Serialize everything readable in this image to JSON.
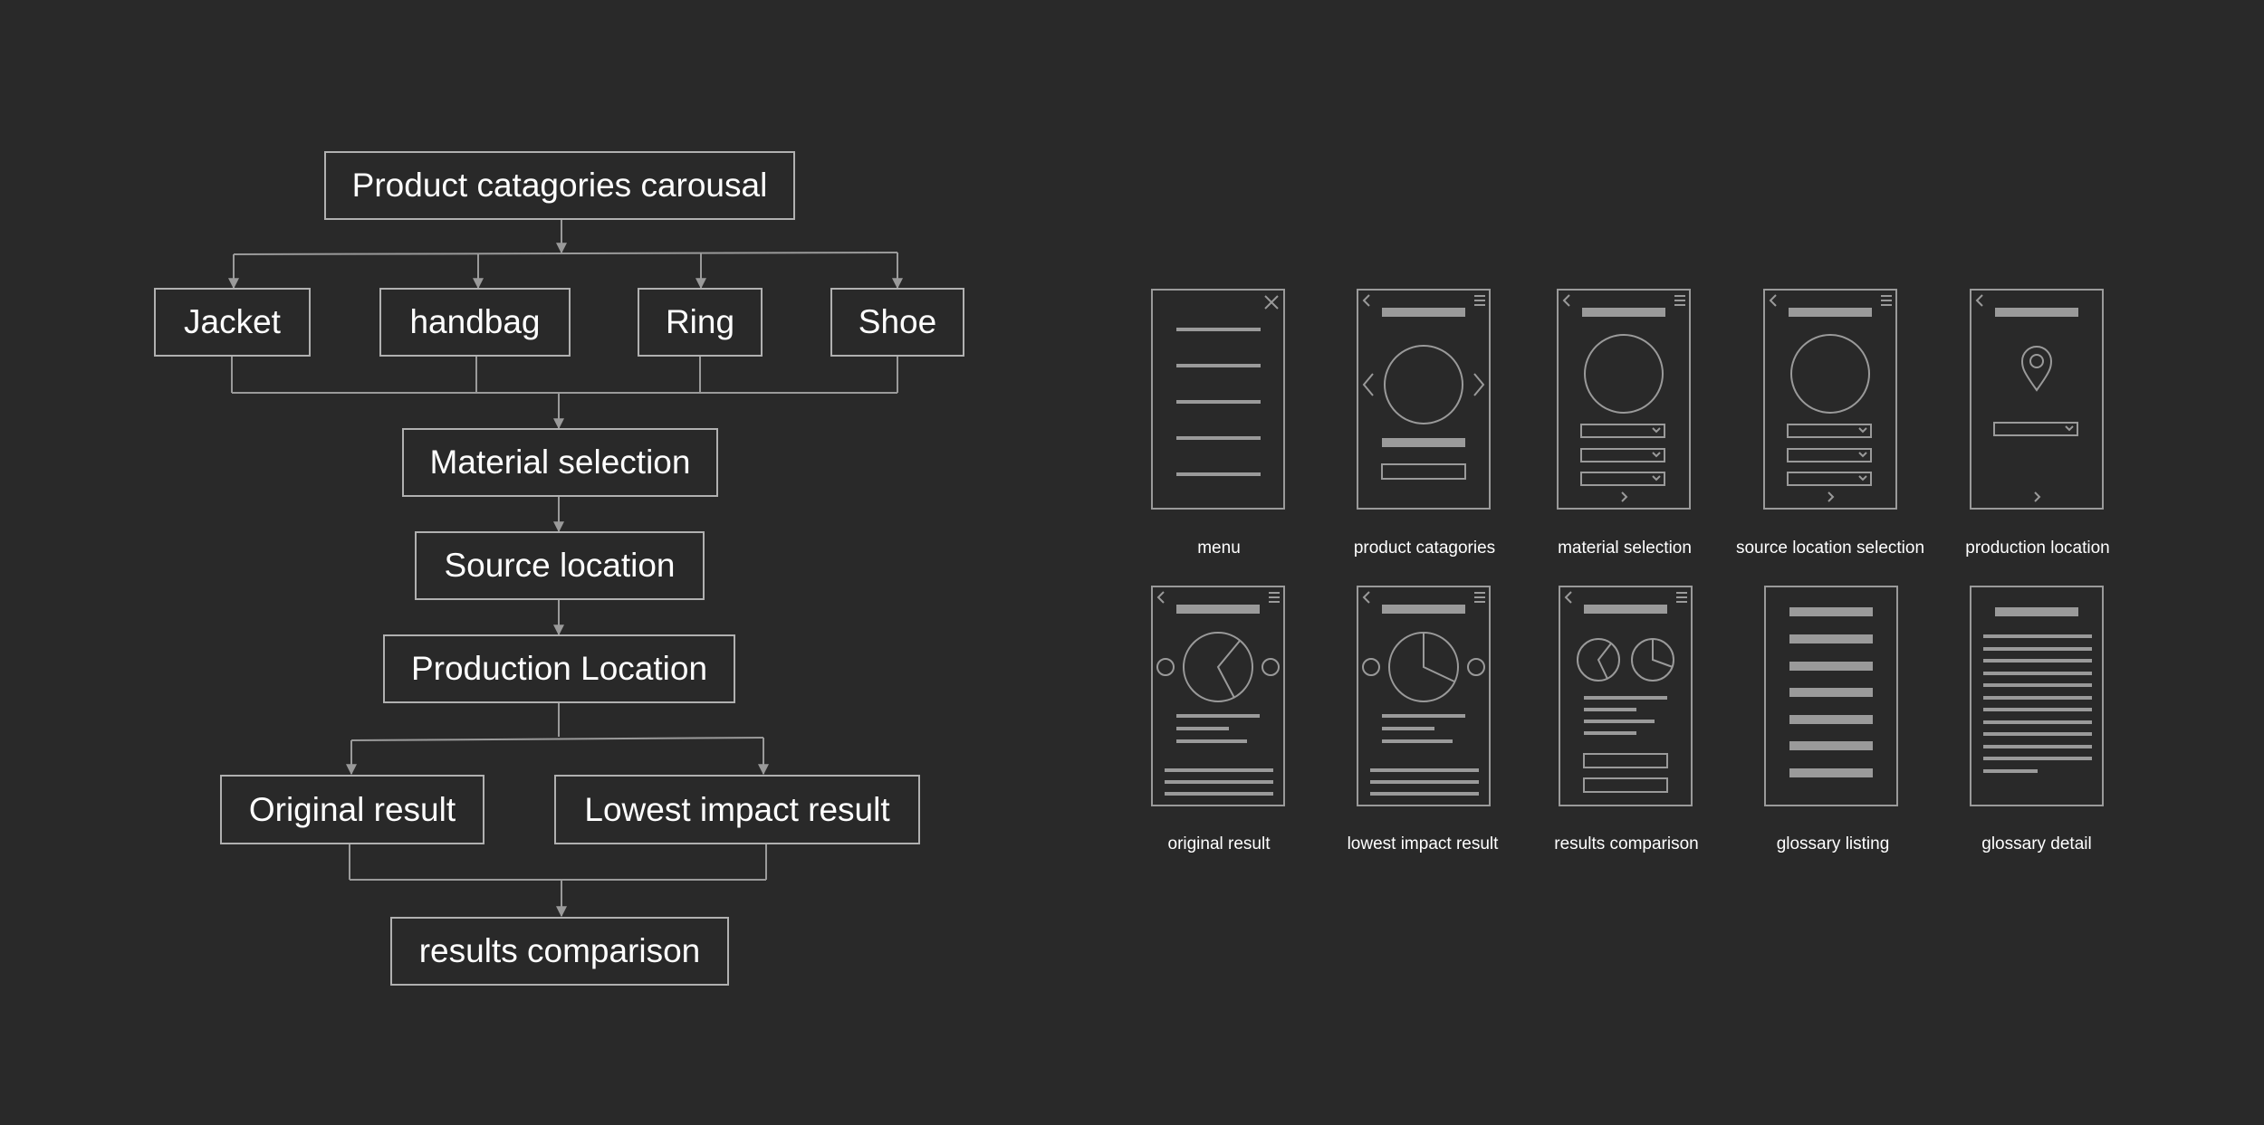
{
  "flowchart": {
    "root": "Product catagories carousal",
    "categories": [
      "Jacket",
      "handbag",
      "Ring",
      "Shoe"
    ],
    "material": "Material selection",
    "source": "Source location",
    "production": "Production Location",
    "results": [
      "Original result",
      "Lowest impact result"
    ],
    "comparison": "results comparison"
  },
  "wireframes": [
    "menu",
    "product catagories",
    "material selection",
    "source location selection",
    "production location",
    "original result",
    "lowest impact result",
    "results comparison",
    "glossary listing",
    "glossary detail"
  ],
  "colors": {
    "background": "#292929",
    "line": "#9a9a9a",
    "text": "#ffffff",
    "bar": "#9a9a9a"
  }
}
